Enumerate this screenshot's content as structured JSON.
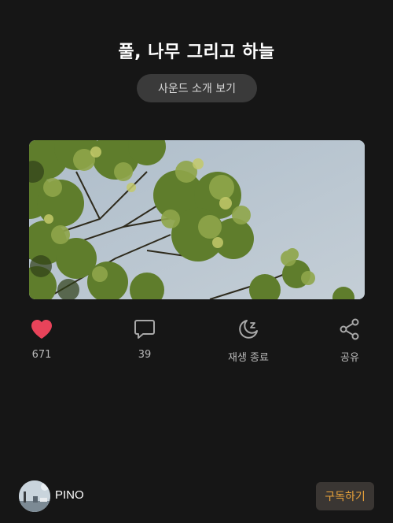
{
  "header": {
    "title": "풀, 나무 그리고 하늘",
    "sound_button_label": "사운드 소개 보기"
  },
  "actions": {
    "like": {
      "icon": "heart-icon",
      "label": "671",
      "color": "#e8435a"
    },
    "comment": {
      "icon": "comment-icon",
      "label": "39"
    },
    "sleep": {
      "icon": "sleep-timer-icon",
      "label": "재생 종료"
    },
    "share": {
      "icon": "share-icon",
      "label": "공유"
    }
  },
  "creator": {
    "name": "PINO",
    "subscribe_label": "구독하기",
    "subscribe_color": "#e8a23b"
  }
}
